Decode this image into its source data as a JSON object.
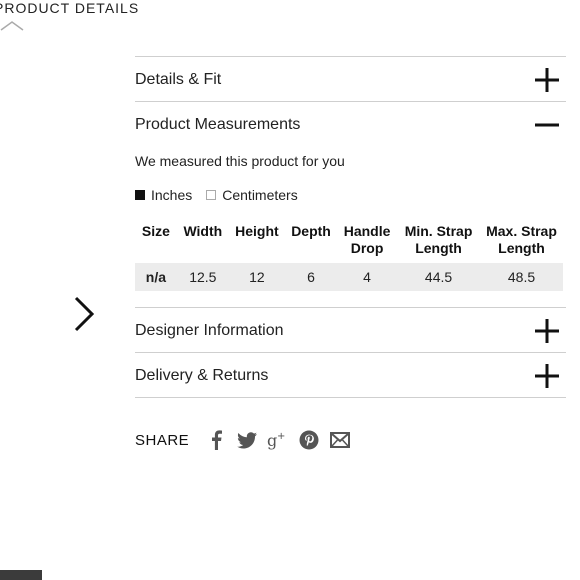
{
  "header": {
    "title": "PRODUCT DETAILS"
  },
  "accordion": {
    "details_fit": {
      "label": "Details & Fit",
      "toggle": "plus-icon"
    },
    "product_measurements": {
      "label": "Product Measurements",
      "toggle": "minus-icon",
      "note": "We measured this product for you",
      "units": [
        {
          "label": "Inches",
          "selected": true
        },
        {
          "label": "Centimeters",
          "selected": false
        }
      ],
      "table": {
        "headers": [
          "Size",
          "Width",
          "Height",
          "Depth",
          "Handle Drop",
          "Min. Strap Length",
          "Max. Strap Length"
        ],
        "rows": [
          [
            "n/a",
            "12.5",
            "12",
            "6",
            "4",
            "44.5",
            "48.5"
          ]
        ]
      }
    },
    "designer_information": {
      "label": "Designer Information",
      "toggle": "plus-icon"
    },
    "delivery_returns": {
      "label": "Delivery & Returns",
      "toggle": "plus-icon"
    }
  },
  "share": {
    "label": "SHARE",
    "icons": [
      "facebook-icon",
      "twitter-icon",
      "google-plus-icon",
      "pinterest-icon",
      "email-icon"
    ]
  }
}
